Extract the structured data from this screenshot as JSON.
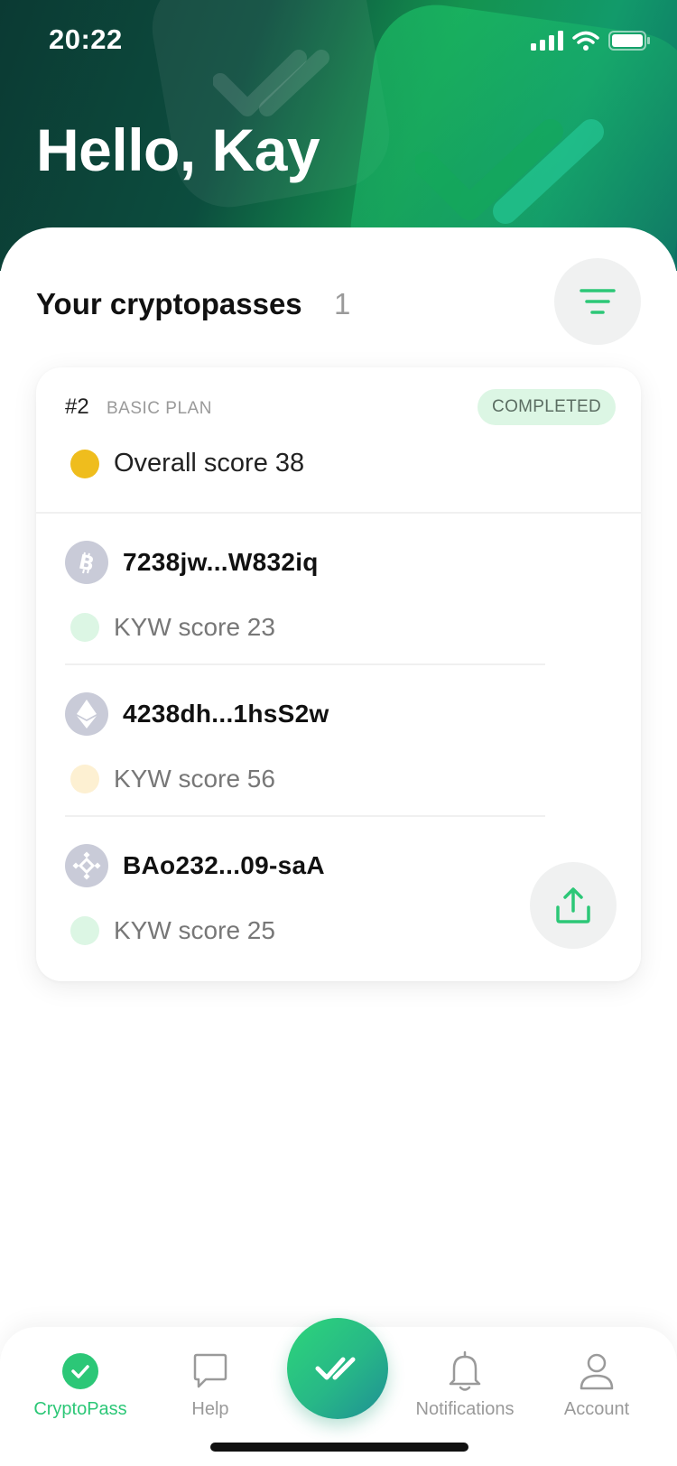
{
  "status_bar": {
    "time": "20:22"
  },
  "header": {
    "greeting": "Hello, Kay"
  },
  "section": {
    "title": "Your cryptopasses",
    "count": "1"
  },
  "card": {
    "plan_id": "#2",
    "plan_name": "BASIC PLAN",
    "status": "COMPLETED",
    "overall_score": "Overall score 38",
    "wallets": [
      {
        "coin": "bitcoin-icon",
        "address": "7238jw...W832iq",
        "score": "KYW score 23",
        "score_color": "#dcf6e4"
      },
      {
        "coin": "ethereum-icon",
        "address": "4238dh...1hsS2w",
        "score": "KYW score 56",
        "score_color": "#fdf0d2"
      },
      {
        "coin": "binance-icon",
        "address": "BAo232...09-saA",
        "score": "KYW score 25",
        "score_color": "#dcf6e4"
      }
    ]
  },
  "nav": {
    "items": [
      {
        "label": "CryptoPass",
        "icon": "check-circle-icon",
        "active": true
      },
      {
        "label": "Help",
        "icon": "chat-bubble-icon",
        "active": false
      },
      {
        "label": "",
        "icon": "double-check-icon",
        "active": false
      },
      {
        "label": "Notifications",
        "icon": "bell-icon",
        "active": false
      },
      {
        "label": "Account",
        "icon": "user-icon",
        "active": false
      }
    ]
  },
  "colors": {
    "accent": "#2cc777",
    "score_yellow": "#efbd1d",
    "badge_bg": "#dcf6e4"
  }
}
